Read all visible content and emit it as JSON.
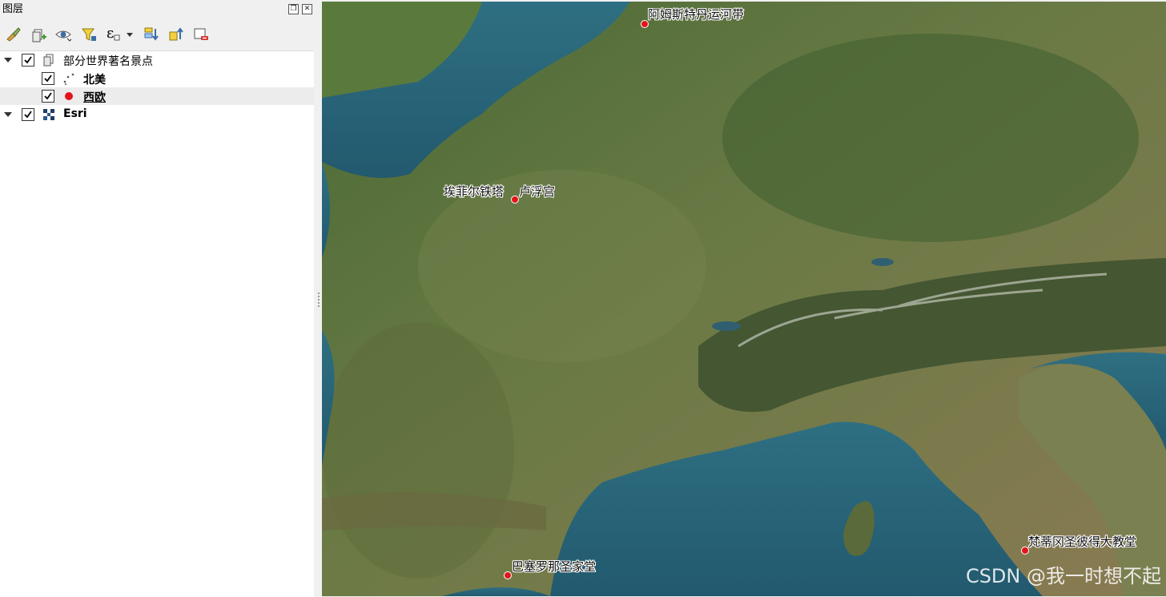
{
  "panel": {
    "title": "图层",
    "float_glyph": "❐",
    "close_glyph": "✕"
  },
  "toolbar": {
    "buttons": [
      {
        "name": "style-manager-icon"
      },
      {
        "name": "add-group-icon"
      },
      {
        "name": "visibility-icon"
      },
      {
        "name": "filter-legend-icon"
      },
      {
        "name": "filter-expression-icon",
        "glyph": "ε"
      },
      {
        "name": "expand-all-icon"
      },
      {
        "name": "collapse-all-icon"
      },
      {
        "name": "remove-layer-icon"
      }
    ]
  },
  "layers": {
    "group": {
      "label": "部分世界著名景点",
      "checked": true
    },
    "north_america": {
      "label": "北美",
      "checked": true
    },
    "western_europe": {
      "label": "西欧",
      "checked": true,
      "symbol_color": "#e3151a"
    },
    "esri": {
      "label": "Esri",
      "checked": true
    }
  },
  "map": {
    "points": [
      {
        "id": "amsterdam",
        "label": "阿姆斯特丹运河带"
      },
      {
        "id": "eiffel",
        "label": "埃菲尔铁塔"
      },
      {
        "id": "louvre",
        "label": "卢浮宫"
      },
      {
        "id": "vatican",
        "label": "梵蒂冈圣彼得大教堂"
      },
      {
        "id": "sagrada",
        "label": "巴塞罗那圣家堂"
      }
    ],
    "point_color": "#e3151a"
  },
  "watermark": "CSDN @我一时想不起"
}
